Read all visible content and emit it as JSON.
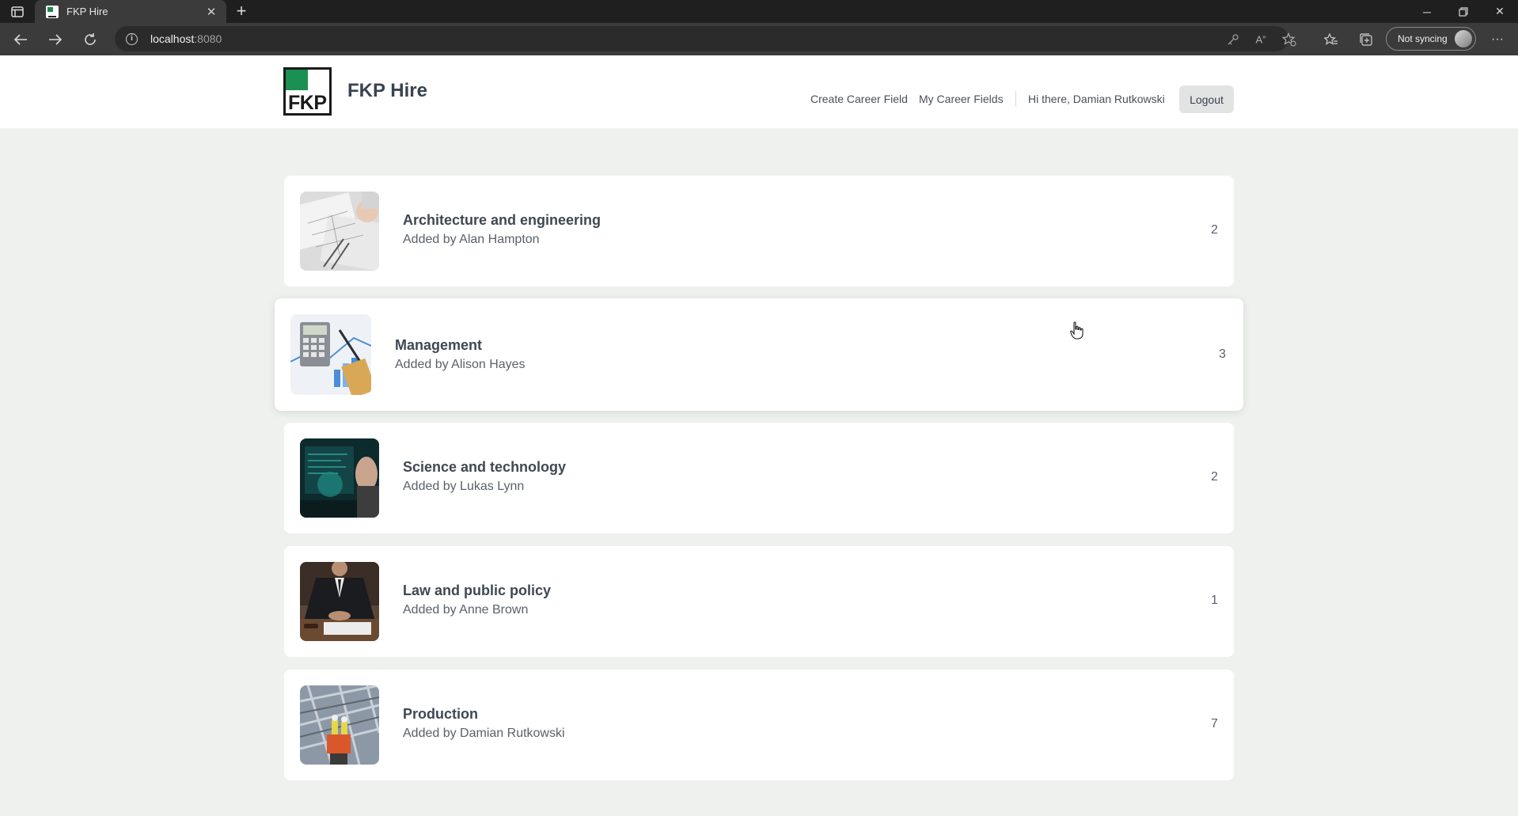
{
  "browser": {
    "tab_title": "FKP Hire",
    "url_host": "localhost",
    "url_port": ":8080",
    "sync_label": "Not syncing"
  },
  "header": {
    "logo_text": "FKP",
    "brand": "FKP Hire",
    "nav": {
      "create": "Create Career Field",
      "mine": "My Career Fields",
      "greeting": "Hi there, Damian Rutkowski",
      "logout": "Logout"
    }
  },
  "career_fields": [
    {
      "title": "Architecture and engineering",
      "added_by": "Added by Alan Hampton",
      "count": "2",
      "image": "architecture-blueprint-image"
    },
    {
      "title": "Management",
      "added_by": "Added by Alison Hayes",
      "count": "3",
      "image": "calculator-charts-image"
    },
    {
      "title": "Science and technology",
      "added_by": "Added by Lukas Lynn",
      "count": "2",
      "image": "tech-screen-image"
    },
    {
      "title": "Law and public policy",
      "added_by": "Added by Anne Brown",
      "count": "1",
      "image": "lawyer-desk-image"
    },
    {
      "title": "Production",
      "added_by": "Added by Damian Rutkowski",
      "count": "7",
      "image": "factory-worker-image"
    }
  ],
  "colors": {
    "page_bg": "#eef1ee",
    "brand_green": "#1a9150",
    "text_dark": "#3f4852",
    "text_muted": "#5a616a"
  }
}
